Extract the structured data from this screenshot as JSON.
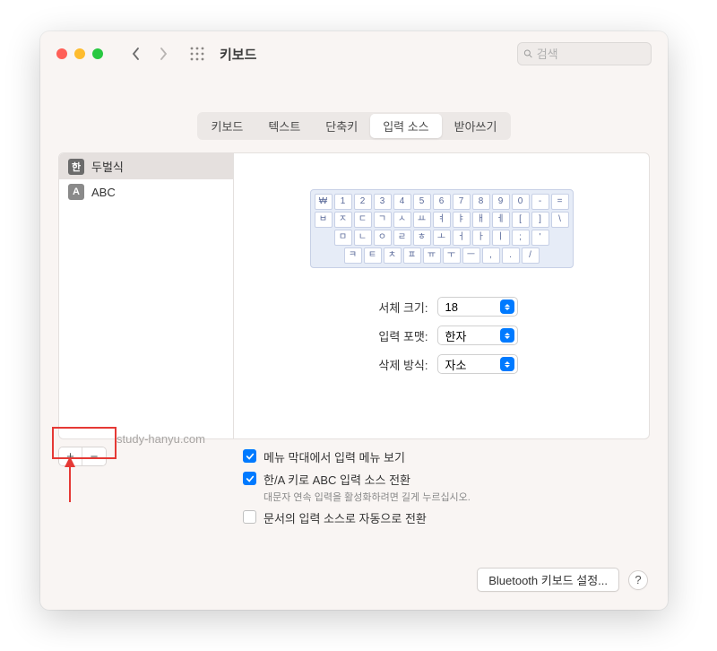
{
  "header": {
    "title": "키보드",
    "search_placeholder": "검색"
  },
  "tabs": [
    "키보드",
    "텍스트",
    "단축키",
    "입력 소스",
    "받아쓰기"
  ],
  "active_tab_index": 3,
  "sources": [
    {
      "icon_text": "한",
      "label": "두벌식",
      "selected": true
    },
    {
      "icon_text": "A",
      "label": "ABC",
      "selected": false
    }
  ],
  "keyboard_rows": [
    [
      "₩",
      "1",
      "2",
      "3",
      "4",
      "5",
      "6",
      "7",
      "8",
      "9",
      "0",
      "-",
      "="
    ],
    [
      "ㅂ",
      "ㅈ",
      "ㄷ",
      "ㄱ",
      "ㅅ",
      "ㅛ",
      "ㅕ",
      "ㅑ",
      "ㅐ",
      "ㅔ",
      "[",
      "]",
      "\\"
    ],
    [
      "ㅁ",
      "ㄴ",
      "ㅇ",
      "ㄹ",
      "ㅎ",
      "ㅗ",
      "ㅓ",
      "ㅏ",
      "ㅣ",
      ";",
      "'"
    ],
    [
      "ㅋ",
      "ㅌ",
      "ㅊ",
      "ㅍ",
      "ㅠ",
      "ㅜ",
      "ㅡ",
      ",",
      ".",
      "/"
    ]
  ],
  "options": {
    "font_size": {
      "label": "서체 크기:",
      "value": "18"
    },
    "input_format": {
      "label": "입력 포맷:",
      "value": "한자"
    },
    "delete_mode": {
      "label": "삭제 방식:",
      "value": "자소"
    }
  },
  "watermark": "study-hanyu.com",
  "checks": [
    {
      "checked": true,
      "label": "메뉴 막대에서 입력 메뉴 보기"
    },
    {
      "checked": true,
      "label": "한/A 키로 ABC 입력 소스 전환",
      "sub": "대문자 연속 입력을 활성화하려면 길게 누르십시오."
    },
    {
      "checked": false,
      "label": "문서의 입력 소스로 자동으로 전환"
    }
  ],
  "footer": {
    "bluetooth": "Bluetooth 키보드 설정...",
    "help": "?"
  },
  "add_label": "+",
  "remove_label": "−"
}
